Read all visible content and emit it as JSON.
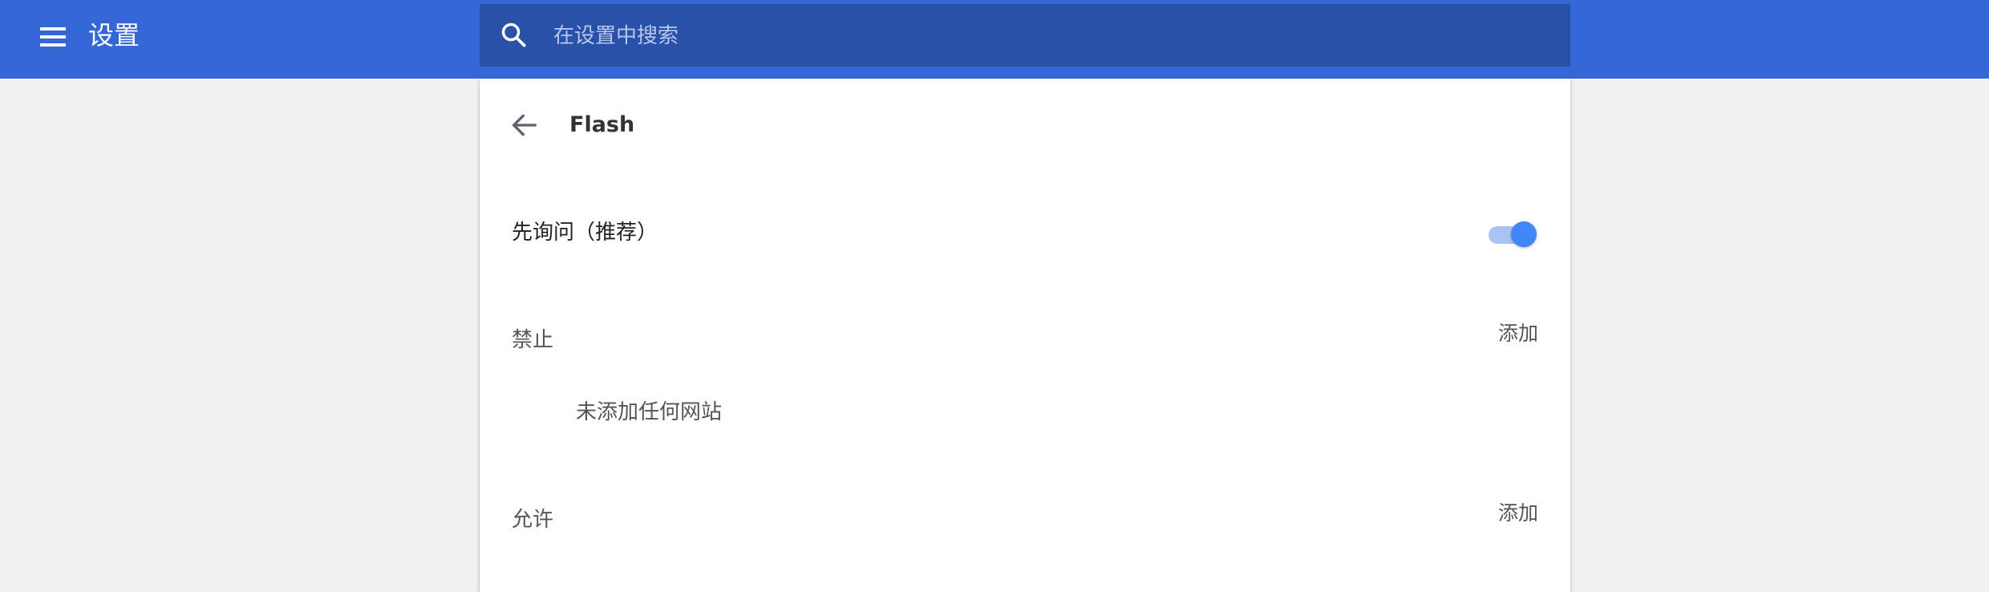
{
  "header": {
    "title": "设置",
    "menu_icon": "menu-icon"
  },
  "search": {
    "placeholder": "在设置中搜索",
    "icon": "search-icon"
  },
  "page": {
    "back_icon": "arrow-back-icon",
    "title": "Flash",
    "ask_first": {
      "label": "先询问（推荐）",
      "enabled": true
    },
    "block": {
      "title": "禁止",
      "add_label": "添加",
      "empty_text": "未添加任何网站"
    },
    "allow": {
      "title": "允许",
      "add_label": "添加"
    }
  },
  "colors": {
    "header_bg": "#3367d6",
    "search_bg": "#2a51a8",
    "toggle_on": "#4285f4",
    "page_bg": "#f1f1f1"
  }
}
